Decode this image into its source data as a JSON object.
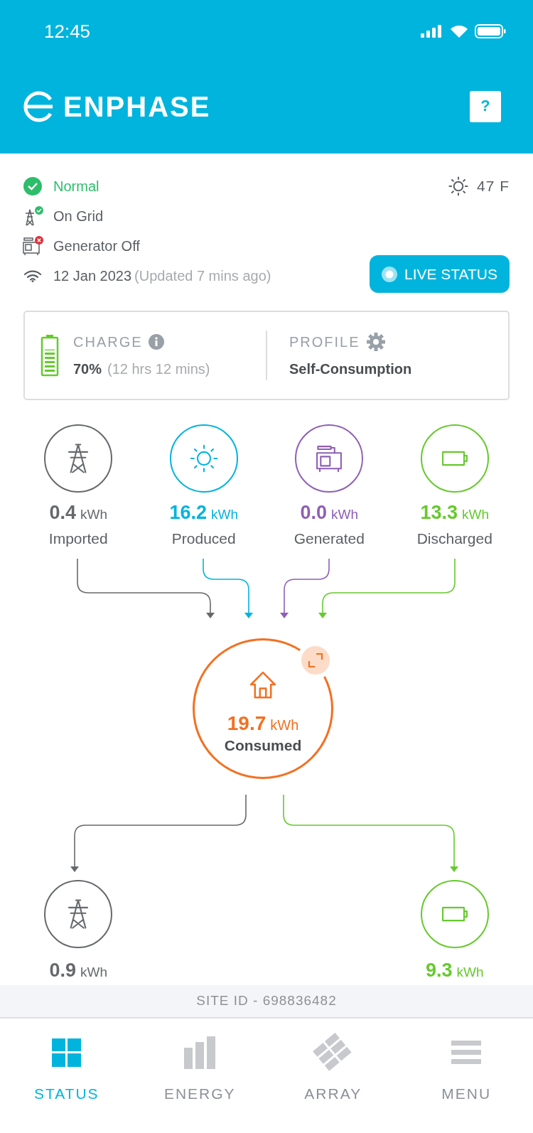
{
  "status_bar": {
    "time": "12:45"
  },
  "header": {
    "logo": "ENPHASE",
    "help": "?"
  },
  "system": {
    "items": [
      {
        "kind": "status",
        "label": "Normal",
        "ok": true
      },
      {
        "kind": "grid",
        "label": "On Grid",
        "ok": true
      },
      {
        "kind": "generator",
        "label": "Generator Off",
        "ok": false
      }
    ],
    "date": "12 Jan 2023",
    "updated": "(Updated 7 mins ago)",
    "weather": "47 F",
    "live_button": "LIVE STATUS"
  },
  "charge": {
    "label": "CHARGE",
    "value": "70%",
    "remaining": "(12 hrs 12 mins)",
    "level": 0.7
  },
  "profile": {
    "label": "PROFILE",
    "value": "Self-Consumption"
  },
  "sources": [
    {
      "kind": "grid",
      "value": "0.4",
      "unit": "kWh",
      "label": "Imported",
      "color": "#66696c"
    },
    {
      "kind": "sun",
      "value": "16.2",
      "unit": "kWh",
      "label": "Produced",
      "color": "#00b4dd"
    },
    {
      "kind": "generator",
      "value": "0.0",
      "unit": "kWh",
      "label": "Generated",
      "color": "#8e5fb4"
    },
    {
      "kind": "battery",
      "value": "13.3",
      "unit": "kWh",
      "label": "Discharged",
      "color": "#66c92e"
    }
  ],
  "consumption": {
    "value": "19.7",
    "unit": "kWh",
    "label": "Consumed"
  },
  "outputs": [
    {
      "kind": "grid",
      "value": "0.9",
      "unit": "kWh",
      "color": "#66696c"
    },
    {
      "kind": "battery",
      "value": "9.3",
      "unit": "kWh",
      "color": "#66c92e"
    }
  ],
  "site_id": "SITE ID - 698836482",
  "tabs": [
    {
      "kind": "status",
      "label": "STATUS",
      "selected": true
    },
    {
      "kind": "energy",
      "label": "ENERGY",
      "selected": false
    },
    {
      "kind": "array",
      "label": "ARRAY",
      "selected": false
    },
    {
      "kind": "menu",
      "label": "MENU",
      "selected": false
    }
  ]
}
